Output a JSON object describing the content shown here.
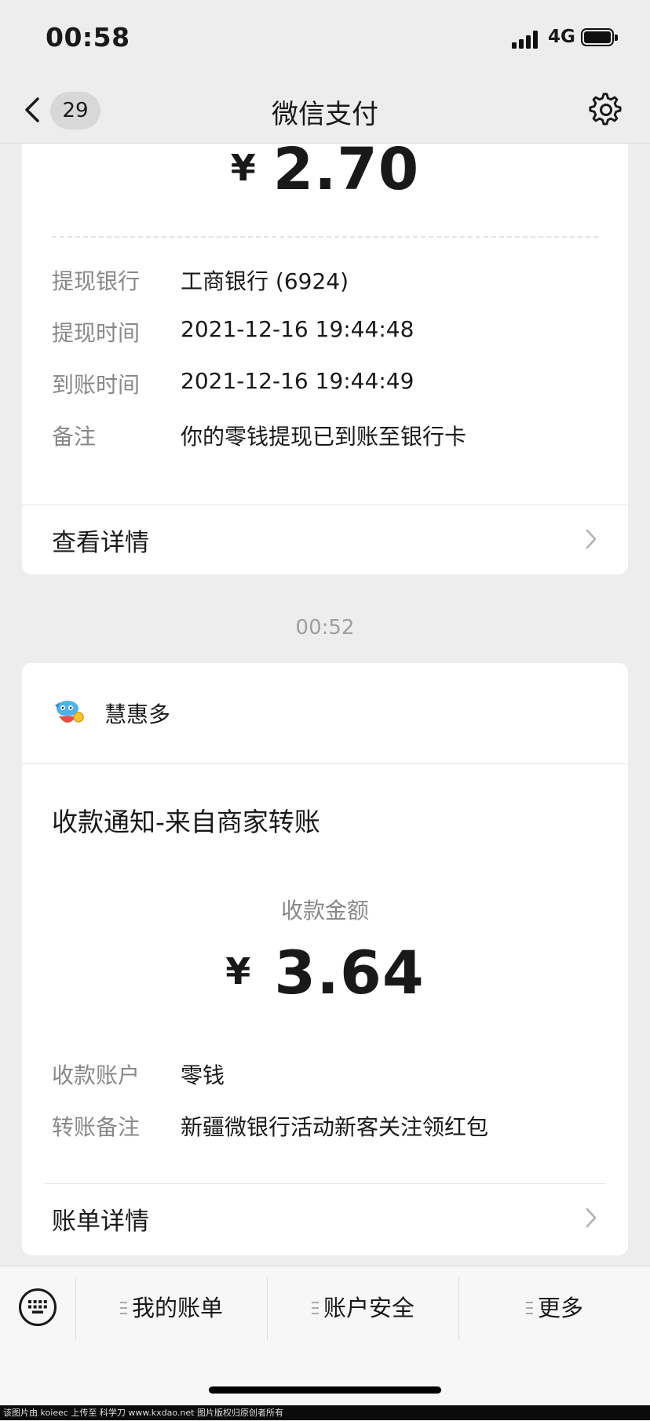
{
  "status_bar": {
    "time": "00:58",
    "network": "4G"
  },
  "nav": {
    "unread_count": "29",
    "title": "微信支付"
  },
  "withdraw_card": {
    "currency": "¥",
    "amount": "2.70",
    "rows": [
      {
        "label": "提现银行",
        "value": "工商银行 (6924)"
      },
      {
        "label": "提现时间",
        "value": "2021-12-16 19:44:48"
      },
      {
        "label": "到账时间",
        "value": "2021-12-16 19:44:49"
      },
      {
        "label": "备注",
        "value": "你的零钱提现已到账至银行卡"
      }
    ],
    "detail_label": "查看详情"
  },
  "timestamp": "00:52",
  "receipt_card": {
    "merchant": "慧惠多",
    "title": "收款通知-来自商家转账",
    "amount_label": "收款金额",
    "currency": "¥",
    "amount": "3.64",
    "rows": [
      {
        "label": "收款账户",
        "value": "零钱"
      },
      {
        "label": "转账备注",
        "value": "新疆微银行活动新客关注领红包"
      }
    ],
    "detail_label": "账单详情"
  },
  "bottom_menu": {
    "items": [
      "我的账单",
      "账户安全",
      "更多"
    ]
  },
  "watermark": "该图片由 koieec 上传至 科学刀 www.kxdao.net 图片版权归原创者所有"
}
